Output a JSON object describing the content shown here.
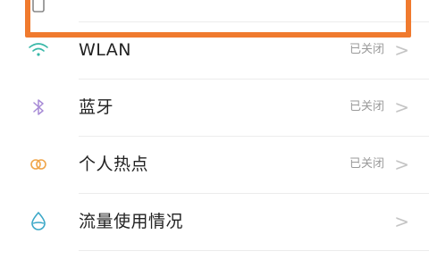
{
  "colors": {
    "highlight": "#f07a2e",
    "wlan_icon": "#39b8a8",
    "bluetooth_icon": "#a78ad6",
    "hotspot_icon": "#f0a54a",
    "data_usage_icon": "#3aa7c7"
  },
  "settings": {
    "top_item": {
      "label": "",
      "icon": "sim-card-icon"
    },
    "items": [
      {
        "label": "WLAN",
        "status": "已关闭",
        "chevron": ">",
        "icon": "wifi-icon"
      },
      {
        "label": "蓝牙",
        "status": "已关闭",
        "chevron": ">",
        "icon": "bluetooth-icon"
      },
      {
        "label": "个人热点",
        "status": "已关闭",
        "chevron": ">",
        "icon": "hotspot-icon"
      },
      {
        "label": "流量使用情况",
        "status": "",
        "chevron": ">",
        "icon": "data-usage-icon"
      }
    ]
  }
}
